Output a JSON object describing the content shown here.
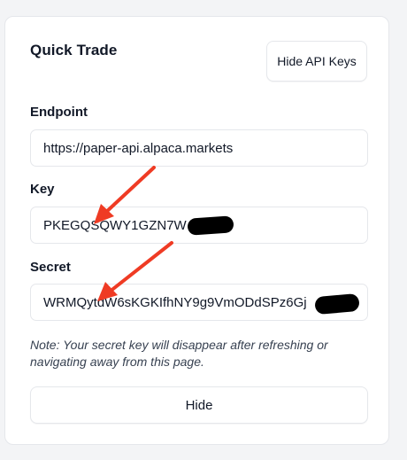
{
  "card": {
    "title": "Quick Trade",
    "hide_api_keys_label": "Hide API Keys",
    "endpoint": {
      "label": "Endpoint",
      "value": "https://paper-api.alpaca.markets"
    },
    "key": {
      "label": "Key",
      "value": "PKEGQSQWY1GZN7W"
    },
    "secret": {
      "label": "Secret",
      "value": "WRMQytdW6sKGKIfhNY9g9VmODdSPz6Gj"
    },
    "note": "Note: Your secret key will disappear after refreshing or navigating away from this page.",
    "hide_label": "Hide"
  },
  "annotations": {
    "arrow_color": "#ef3b24",
    "redaction_color": "#000000"
  }
}
